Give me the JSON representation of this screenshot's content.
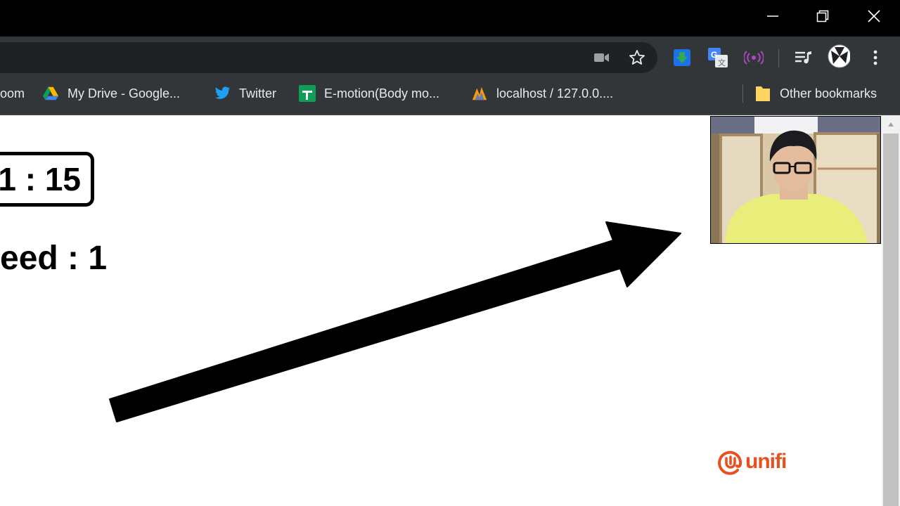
{
  "window": {
    "controls": [
      "minimize-icon",
      "restore-icon",
      "close-icon"
    ]
  },
  "toolbar": {
    "icons": [
      "video-camera-icon",
      "star-icon",
      "download-extension-icon",
      "google-translate-icon",
      "cast-broadcast-icon",
      "media-queue-icon",
      "profile-avatar-icon",
      "more-menu-icon"
    ]
  },
  "bookmarks": {
    "items": [
      {
        "label": "oom",
        "icon": "zoom-icon"
      },
      {
        "label": "My Drive - Google...",
        "icon": "google-drive-icon"
      },
      {
        "label": "Twitter",
        "icon": "twitter-icon"
      },
      {
        "label": "E-motion(Body mo...",
        "icon": "google-sheets-icon"
      },
      {
        "label": "localhost / 127.0.0....",
        "icon": "phpmyadmin-icon"
      }
    ],
    "other_label": "Other bookmarks"
  },
  "content": {
    "timer": "1 : 15",
    "speed": "eed : 1",
    "logo": "unifi"
  },
  "colors": {
    "titlebar": "#000000",
    "toolbar": "#323639",
    "omnibox": "#202124",
    "unifi_orange": "#e8501e",
    "twitter_blue": "#1da1f2",
    "sheets_green": "#0f9d58"
  }
}
